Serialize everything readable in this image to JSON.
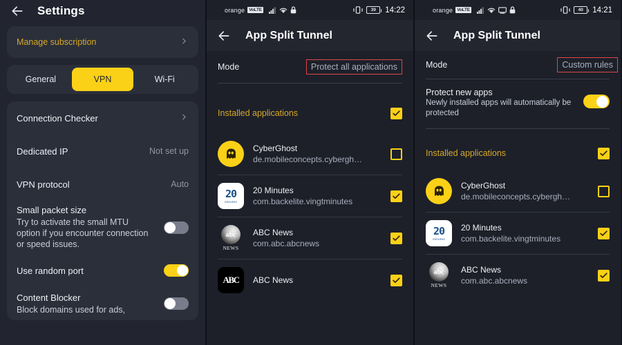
{
  "left_panel": {
    "back_icon": "back-arrow-icon",
    "title": "Settings",
    "manage_subscription": {
      "label": "Manage subscription",
      "chevron": "chevron-right-icon"
    },
    "tabs": [
      {
        "label": "General",
        "active": false
      },
      {
        "label": "VPN",
        "active": true
      },
      {
        "label": "Wi-Fi",
        "active": false
      }
    ],
    "rows": [
      {
        "title": "Connection Checker",
        "value": "",
        "chevron": true
      },
      {
        "title": "Dedicated IP",
        "value": "Not set up",
        "chevron": false
      },
      {
        "title": "VPN protocol",
        "value": "Auto",
        "chevron": false
      },
      {
        "title": "Small packet size",
        "sub": "Try to activate the small MTU option if you encounter connection or speed issues.",
        "toggle": "off"
      },
      {
        "title": "Use random port",
        "sub": "",
        "toggle": "on"
      },
      {
        "title": "Content Blocker",
        "sub": "Block domains used for ads,",
        "toggle": "off"
      }
    ],
    "accent_yellow": "#fbd117",
    "accent_gold_text": "#d6a829"
  },
  "middle_panel": {
    "statusbar": {
      "carrier": "orange",
      "volte_badge": "VoLTE",
      "signal_icon": "signal-bars-icon",
      "wifi_icon": "wifi-icon",
      "lock_icon": "lock-icon",
      "vibrate_icon": "vibrate-icon",
      "battery_level": "39",
      "time": "14:22"
    },
    "header": {
      "back_icon": "back-arrow-icon",
      "title": "App Split Tunnel"
    },
    "mode": {
      "label": "Mode",
      "value": "Protect all applications",
      "highlight_color": "#e0464a"
    },
    "installed_section": {
      "label": "Installed applications",
      "checkbox": "checked"
    },
    "apps": [
      {
        "name": "CyberGhost",
        "package": "de.mobileconcepts.cybergh…",
        "icon": "cyberghost-icon",
        "checkbox": "unchecked"
      },
      {
        "name": "20 Minutes",
        "package": "com.backelite.vingtminutes",
        "icon": "20minutes-icon",
        "checkbox": "checked"
      },
      {
        "name": "ABC News",
        "package": "com.abc.abcnews",
        "icon": "abc-news-us-icon",
        "checkbox": "checked"
      },
      {
        "name": "ABC News",
        "package": "",
        "icon": "abc-news-au-icon",
        "checkbox": "checked"
      }
    ]
  },
  "right_panel": {
    "statusbar": {
      "carrier": "orange",
      "volte_badge": "VoLTE",
      "signal_icon": "signal-bars-icon",
      "wifi_icon": "wifi-icon",
      "cast_icon": "cast-screen-icon",
      "lock_icon": "lock-icon",
      "vibrate_icon": "vibrate-icon",
      "battery_level": "40",
      "time": "14:21"
    },
    "header": {
      "back_icon": "back-arrow-icon",
      "title": "App Split Tunnel"
    },
    "mode": {
      "label": "Mode",
      "value": "Custom rules",
      "highlight_color": "#e0464a"
    },
    "protect_new_apps": {
      "title": "Protect new apps",
      "sub": "Newly installed apps will automatically be protected",
      "toggle": "on"
    },
    "installed_section": {
      "label": "Installed applications",
      "checkbox": "checked"
    },
    "apps": [
      {
        "name": "CyberGhost",
        "package": "de.mobileconcepts.cybergh…",
        "icon": "cyberghost-icon",
        "checkbox": "unchecked"
      },
      {
        "name": "20 Minutes",
        "package": "com.backelite.vingtminutes",
        "icon": "20minutes-icon",
        "checkbox": "checked"
      },
      {
        "name": "ABC News",
        "package": "com.abc.abcnews",
        "icon": "abc-news-us-icon",
        "checkbox": "checked"
      }
    ]
  }
}
